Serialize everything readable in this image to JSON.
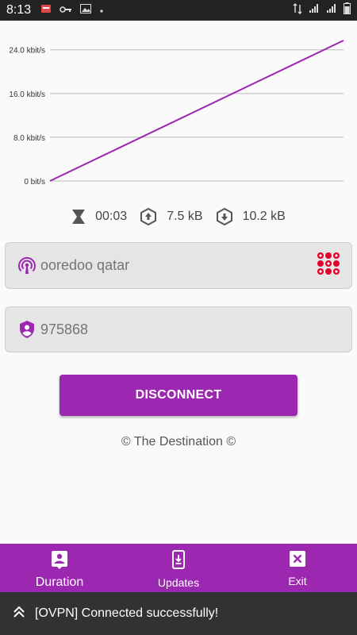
{
  "status_bar": {
    "time": "8:13",
    "icons_left": [
      "notification-icon",
      "key-icon",
      "image-icon",
      "dot-icon"
    ],
    "icons_right": [
      "data-arrows-icon",
      "signal-icon",
      "signal-icon-2",
      "battery-icon"
    ]
  },
  "chart_data": {
    "type": "line",
    "title": "",
    "xlabel": "",
    "ylabel": "",
    "y_tick_labels": [
      "24.0 kbit/s",
      "16.0 kbit/s",
      "8.0 kbit/s",
      "0 bit/s"
    ],
    "y_ticks": [
      24.0,
      16.0,
      8.0,
      0
    ],
    "ylim": [
      0,
      27.3
    ],
    "x": [
      0,
      1
    ],
    "series": [
      {
        "values": [
          0,
          25.7
        ]
      }
    ],
    "grid": true,
    "line_color": "#9c27b0"
  },
  "stats": {
    "duration": "00:03",
    "upload": "7.5 kB",
    "download": "10.2 kB"
  },
  "server_field": {
    "placeholder": "ooredoo qatar",
    "icon": "broadcast-icon"
  },
  "code_field": {
    "placeholder": "975868",
    "icon": "shield-user-icon"
  },
  "disconnect_label": "DISCONNECT",
  "footer": "© The Destination ©",
  "bottom_nav": {
    "items": [
      {
        "label": "Duration",
        "icon": "person-badge-icon"
      },
      {
        "label": "Updates",
        "icon": "phone-download-icon"
      },
      {
        "label": "Exit",
        "icon": "close-box-icon"
      }
    ]
  },
  "snackbar": {
    "text": "[OVPN] Connected successfully!",
    "icon": "double-chevron-up-icon"
  },
  "colors": {
    "accent": "#9c27b0",
    "status_bar": "#232323",
    "snackbar": "#323232"
  }
}
